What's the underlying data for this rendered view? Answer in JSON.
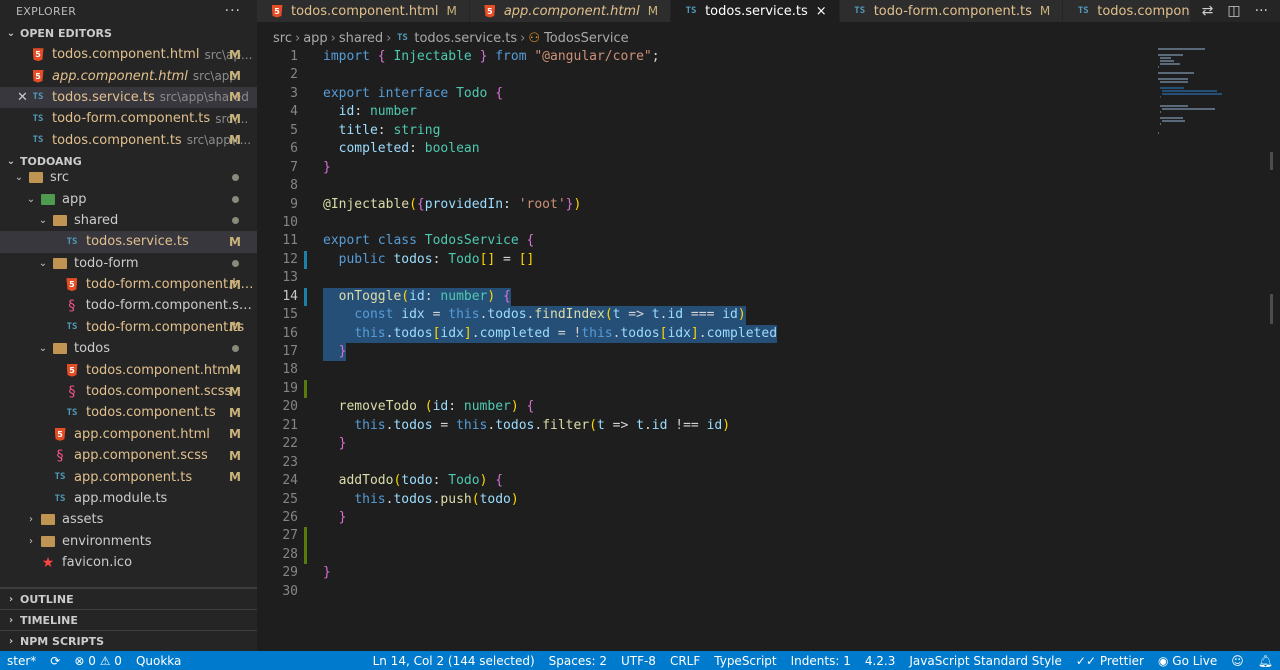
{
  "explorer": {
    "title": "EXPLORER",
    "more_icon": "ellipsis-icon",
    "open_editors": {
      "title": "OPEN EDITORS",
      "items": [
        {
          "name": "todos.component.html",
          "path": "src\\ap...",
          "badge": "M",
          "type": "html",
          "italic": false
        },
        {
          "name": "app.component.html",
          "path": "src\\app",
          "badge": "M",
          "type": "html",
          "italic": true
        },
        {
          "name": "todos.service.ts",
          "path": "src\\app\\shared",
          "badge": "M",
          "type": "ts",
          "italic": false,
          "active": true
        },
        {
          "name": "todo-form.component.ts",
          "path": "src\\...",
          "badge": "M",
          "type": "ts",
          "italic": false
        },
        {
          "name": "todos.component.ts",
          "path": "src\\app\\t...",
          "badge": "M",
          "type": "ts",
          "italic": false
        }
      ]
    },
    "workspace": {
      "title": "TODOANG",
      "tree": [
        {
          "name": "src",
          "kind": "folder",
          "depth": 0,
          "dot": true
        },
        {
          "name": "app",
          "kind": "folder-green",
          "depth": 1,
          "dot": true
        },
        {
          "name": "shared",
          "kind": "folder",
          "depth": 2,
          "dot": true
        },
        {
          "name": "todos.service.ts",
          "kind": "ts",
          "depth": 3,
          "badge": "M",
          "active": true
        },
        {
          "name": "todo-form",
          "kind": "folder",
          "depth": 2,
          "dot": true
        },
        {
          "name": "todo-form.component.ht...",
          "kind": "html",
          "depth": 3,
          "badge": "M"
        },
        {
          "name": "todo-form.component.scss",
          "kind": "scss",
          "depth": 3
        },
        {
          "name": "todo-form.component.ts",
          "kind": "ts",
          "depth": 3,
          "badge": "M"
        },
        {
          "name": "todos",
          "kind": "folder",
          "depth": 2,
          "dot": true
        },
        {
          "name": "todos.component.html",
          "kind": "html",
          "depth": 3,
          "badge": "M"
        },
        {
          "name": "todos.component.scss",
          "kind": "scss",
          "depth": 3,
          "badge": "M"
        },
        {
          "name": "todos.component.ts",
          "kind": "ts",
          "depth": 3,
          "badge": "M"
        },
        {
          "name": "app.component.html",
          "kind": "html",
          "depth": 2,
          "badge": "M"
        },
        {
          "name": "app.component.scss",
          "kind": "scss",
          "depth": 2,
          "badge": "M"
        },
        {
          "name": "app.component.ts",
          "kind": "ts",
          "depth": 2,
          "badge": "M"
        },
        {
          "name": "app.module.ts",
          "kind": "ts",
          "depth": 2
        },
        {
          "name": "assets",
          "kind": "folder-closed",
          "depth": 1
        },
        {
          "name": "environments",
          "kind": "folder-closed",
          "depth": 1
        },
        {
          "name": "favicon.ico",
          "kind": "star",
          "depth": 1
        }
      ]
    },
    "outline": "OUTLINE",
    "timeline": "TIMELINE",
    "npm_scripts": "NPM SCRIPTS"
  },
  "tabs": [
    {
      "label": "todos.component.html",
      "type": "html",
      "modified": "M"
    },
    {
      "label": "app.component.html",
      "type": "html",
      "modified": "M",
      "italic": true
    },
    {
      "label": "todos.service.ts",
      "type": "ts",
      "active": true,
      "close": "×"
    },
    {
      "label": "todo-form.component.ts",
      "type": "ts",
      "modified": "M"
    },
    {
      "label": "todos.component.ts",
      "type": "ts",
      "modified": "M"
    }
  ],
  "breadcrumb": [
    "src",
    "app",
    "shared",
    "todos.service.ts",
    "TodosService"
  ],
  "editor": {
    "lines": [
      "import { Injectable } from \"@angular/core\";",
      "",
      "export interface Todo {",
      "  id: number",
      "  title: string",
      "  completed: boolean",
      "}",
      "",
      "@Injectable({providedIn: 'root'})",
      "",
      "export class TodosService {",
      "  public todos: Todo[] = []",
      "",
      "  onToggle(id: number) {",
      "    const idx = this.todos.findIndex(t => t.id === id)",
      "    this.todos[idx].completed = !this.todos[idx].completed",
      "  }",
      "",
      "",
      "  removeTodo (id: number) {",
      "    this.todos = this.todos.filter(t => t.id !== id)",
      "  }",
      "",
      "  addTodo(todo: Todo) {",
      "    this.todos.push(todo)",
      "  }",
      "",
      "",
      "}",
      ""
    ],
    "current_line": 14
  },
  "statusbar": {
    "branch": "ster*",
    "sync_icon": "sync-icon",
    "errors": "0",
    "warnings": "0",
    "quokka": "Quokka",
    "position": "Ln 14, Col 2 (144 selected)",
    "spaces": "Spaces: 2",
    "encoding": "UTF-8",
    "eol": "CRLF",
    "language": "TypeScript",
    "indents": "Indents: 1",
    "version": "4.2.3",
    "linter": "JavaScript Standard Style",
    "prettier": "Prettier",
    "golive": "Go Live"
  },
  "colors": {
    "accent": "#007acc",
    "modified": "#c9b37b",
    "selection": "#264f78"
  }
}
